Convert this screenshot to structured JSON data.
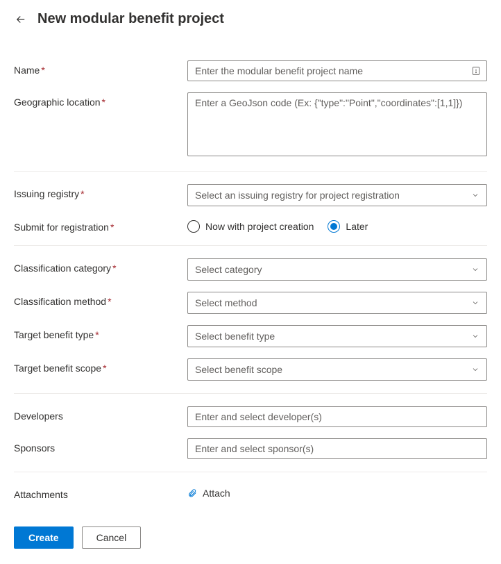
{
  "header": {
    "title": "New modular benefit project"
  },
  "fields": {
    "name": {
      "label": "Name",
      "placeholder": "Enter the modular benefit project name",
      "required": true
    },
    "geo": {
      "label": "Geographic location",
      "placeholder": "Enter a GeoJson code (Ex: {\"type\":\"Point\",\"coordinates\":[1,1]})",
      "required": true
    },
    "registry": {
      "label": "Issuing registry",
      "placeholder": "Select an issuing registry for project registration",
      "required": true
    },
    "submit": {
      "label": "Submit for registration",
      "required": true,
      "options": {
        "now": "Now with project creation",
        "later": "Later"
      },
      "selected": "later"
    },
    "category": {
      "label": "Classification category",
      "placeholder": "Select category",
      "required": true
    },
    "method": {
      "label": "Classification method",
      "placeholder": "Select method",
      "required": true
    },
    "benefit_type": {
      "label": "Target benefit type",
      "placeholder": "Select benefit type",
      "required": true
    },
    "benefit_scope": {
      "label": "Target benefit scope",
      "placeholder": "Select benefit scope",
      "required": true
    },
    "developers": {
      "label": "Developers",
      "placeholder": "Enter and select developer(s)",
      "required": false
    },
    "sponsors": {
      "label": "Sponsors",
      "placeholder": "Enter and select sponsor(s)",
      "required": false
    },
    "attachments": {
      "label": "Attachments",
      "action": "Attach"
    }
  },
  "footer": {
    "create": "Create",
    "cancel": "Cancel"
  }
}
